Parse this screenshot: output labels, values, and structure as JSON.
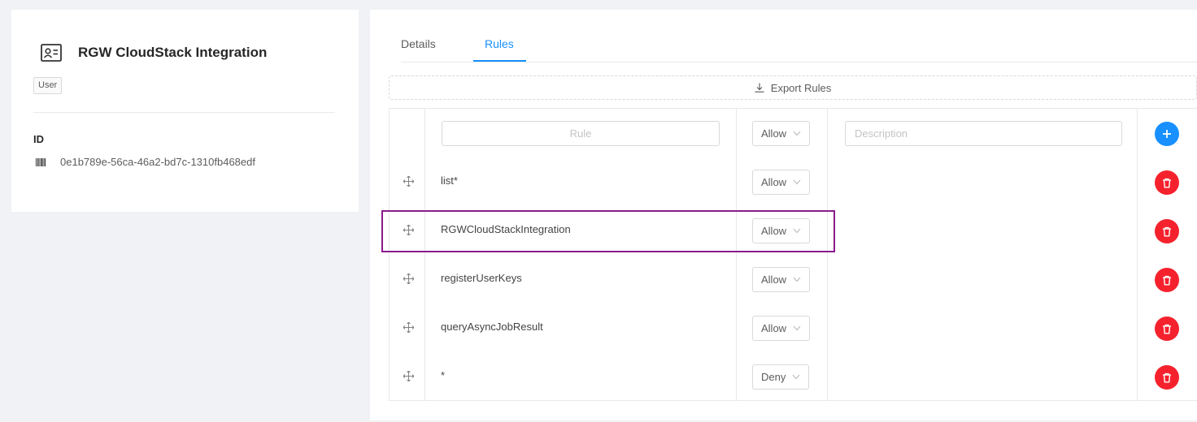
{
  "left": {
    "icon": "profile-card-icon",
    "title": "RGW CloudStack Integration",
    "tag": "User",
    "id_label": "ID",
    "id_icon": "barcode-icon",
    "id_value": "0e1b789e-56ca-46a2-bd7c-1310fb468edf"
  },
  "tabs": {
    "details": "Details",
    "rules": "Rules",
    "active": "Rules"
  },
  "export": {
    "label": "Export Rules",
    "icon": "download-icon"
  },
  "new_rule": {
    "rule_placeholder": "Rule",
    "permission": "Allow",
    "description_placeholder": "Description",
    "add_icon": "plus-icon"
  },
  "rules": [
    {
      "rule": "list*",
      "permission": "Allow"
    },
    {
      "rule": "RGWCloudStackIntegration",
      "permission": "Allow"
    },
    {
      "rule": "registerUserKeys",
      "permission": "Allow"
    },
    {
      "rule": "queryAsyncJobResult",
      "permission": "Allow"
    },
    {
      "rule": "*",
      "permission": "Deny"
    }
  ],
  "colors": {
    "primary": "#1890ff",
    "danger": "#f5222d",
    "highlight": "#8b1a8b"
  }
}
